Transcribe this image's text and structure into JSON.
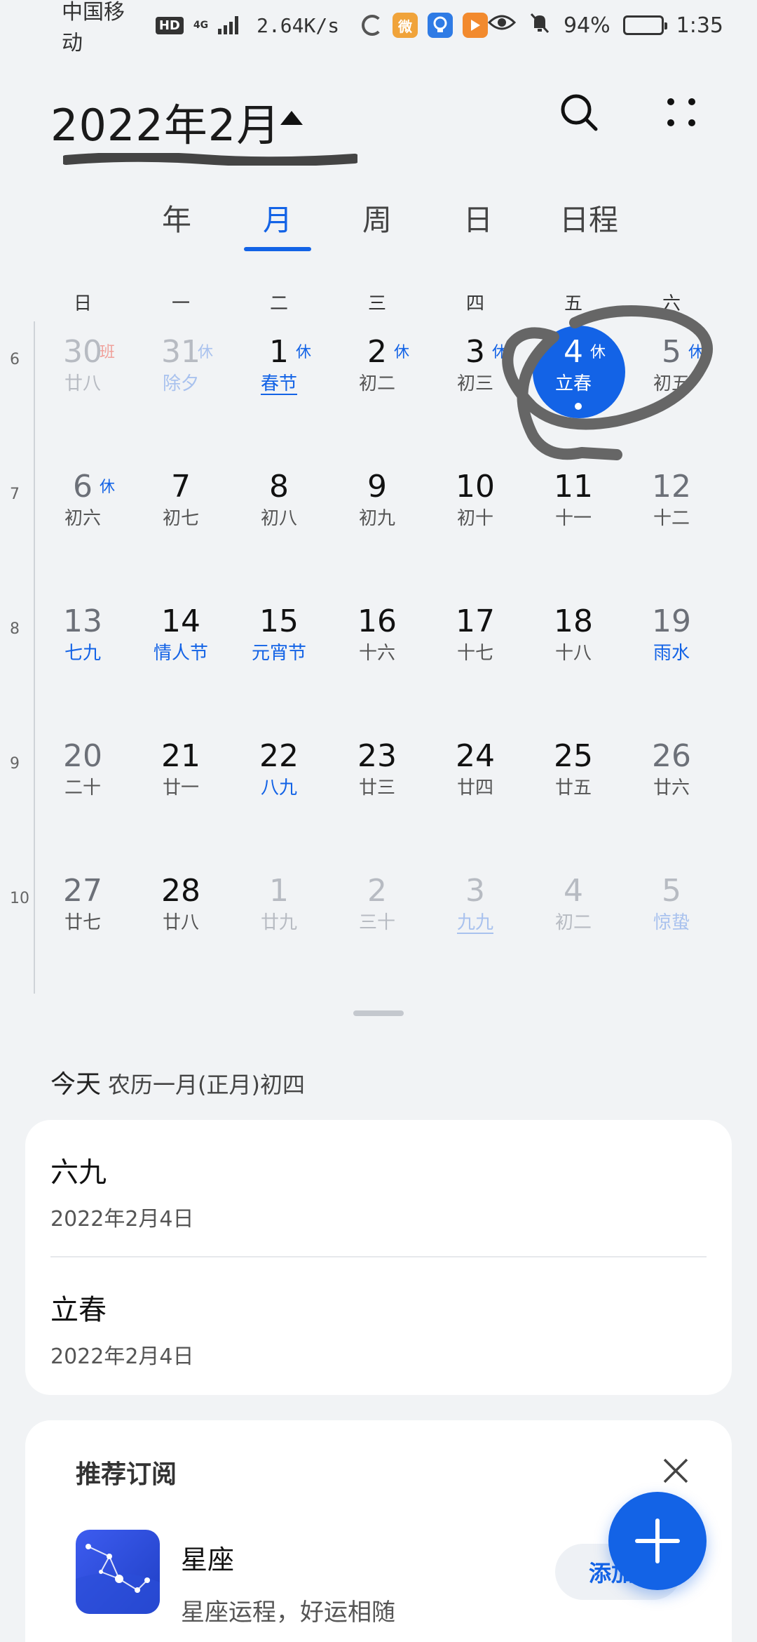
{
  "status_bar": {
    "carrier": "中国移动",
    "hd": "HD",
    "network": "4G",
    "speed": "2.64K/s",
    "battery": "94%",
    "battery_level": 0.94,
    "time": "1:35"
  },
  "header": {
    "title": "2022年2月"
  },
  "tabs": [
    {
      "label": "年"
    },
    {
      "label": "月"
    },
    {
      "label": "周"
    },
    {
      "label": "日"
    },
    {
      "label": "日程"
    }
  ],
  "weekdays": [
    "日",
    "一",
    "二",
    "三",
    "四",
    "五",
    "六"
  ],
  "weeks": [
    {
      "num": "6",
      "days": [
        {
          "d": "30",
          "l": "廿八",
          "tag": "班",
          "dim": true,
          "tagColor": "red"
        },
        {
          "d": "31",
          "l": "除夕",
          "tag": "休",
          "dim": true,
          "tagColor": "lightblue",
          "lunarBlue": true
        },
        {
          "d": "1",
          "l": "春节",
          "tag": "休",
          "lunarBlue": true,
          "underline": true
        },
        {
          "d": "2",
          "l": "初二",
          "tag": "休"
        },
        {
          "d": "3",
          "l": "初三",
          "tag": "休"
        },
        {
          "d": "4",
          "l": "立春",
          "tag": "休",
          "today": true
        },
        {
          "d": "5",
          "l": "初五",
          "tag": "休",
          "weekend": true
        }
      ]
    },
    {
      "num": "7",
      "days": [
        {
          "d": "6",
          "l": "初六",
          "tag": "休",
          "weekend": true
        },
        {
          "d": "7",
          "l": "初七"
        },
        {
          "d": "8",
          "l": "初八"
        },
        {
          "d": "9",
          "l": "初九"
        },
        {
          "d": "10",
          "l": "初十"
        },
        {
          "d": "11",
          "l": "十一"
        },
        {
          "d": "12",
          "l": "十二",
          "weekend": true
        }
      ]
    },
    {
      "num": "8",
      "days": [
        {
          "d": "13",
          "l": "七九",
          "lunarBlue": true,
          "weekend": true
        },
        {
          "d": "14",
          "l": "情人节",
          "lunarBlue": true
        },
        {
          "d": "15",
          "l": "元宵节",
          "lunarBlue": true
        },
        {
          "d": "16",
          "l": "十六"
        },
        {
          "d": "17",
          "l": "十七"
        },
        {
          "d": "18",
          "l": "十八"
        },
        {
          "d": "19",
          "l": "雨水",
          "lunarBlue": true,
          "weekend": true
        }
      ]
    },
    {
      "num": "9",
      "days": [
        {
          "d": "20",
          "l": "二十",
          "weekend": true
        },
        {
          "d": "21",
          "l": "廿一"
        },
        {
          "d": "22",
          "l": "八九",
          "lunarBlue": true
        },
        {
          "d": "23",
          "l": "廿三"
        },
        {
          "d": "24",
          "l": "廿四"
        },
        {
          "d": "25",
          "l": "廿五"
        },
        {
          "d": "26",
          "l": "廿六",
          "weekend": true
        }
      ]
    },
    {
      "num": "10",
      "days": [
        {
          "d": "27",
          "l": "廿七",
          "weekend": true
        },
        {
          "d": "28",
          "l": "廿八"
        },
        {
          "d": "1",
          "l": "廿九",
          "dim": true
        },
        {
          "d": "2",
          "l": "三十",
          "dim": true
        },
        {
          "d": "3",
          "l": "九九",
          "dim": true,
          "lunarBlue": true,
          "underline": true
        },
        {
          "d": "4",
          "l": "初二",
          "dim": true
        },
        {
          "d": "5",
          "l": "惊蛰",
          "dim": true,
          "lunarBlue": true
        }
      ]
    }
  ],
  "today": {
    "label": "今天",
    "lunar": "农历一月(正月)初四"
  },
  "events": [
    {
      "title": "六九",
      "date": "2022年2月4日"
    },
    {
      "title": "立春",
      "date": "2022年2月4日"
    }
  ],
  "recommend": {
    "title": "推荐订阅",
    "app_name": "星座",
    "app_desc": "星座运程，好运相随",
    "add_label": "添加"
  },
  "colors": {
    "accent": "#1363e6",
    "background": "#f1f3f5"
  }
}
